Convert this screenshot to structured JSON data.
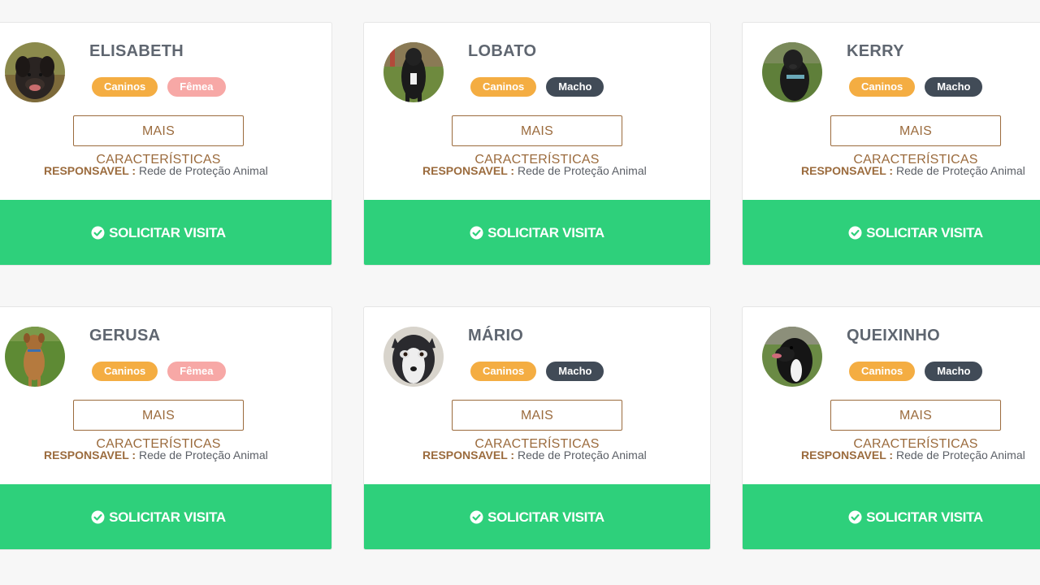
{
  "colors": {
    "species_tag": "#f4ad42",
    "female_tag": "#f7a8a6",
    "male_tag": "#414b57",
    "visit_button": "#2ed07b",
    "accent_brown": "#9b6b3d"
  },
  "cards": [
    {
      "name": "ELISABETH",
      "species": "Caninos",
      "sex": "Fêmea",
      "sex_kind": "female",
      "more_label": "MAIS CARACTERÍSTICAS",
      "owner_label": "RESPONSAVEL :",
      "owner_value": "Rede de Proteção Animal",
      "visit_label": "SOLICITAR VISITA"
    },
    {
      "name": "LOBATO",
      "species": "Caninos",
      "sex": "Macho",
      "sex_kind": "male",
      "more_label": "MAIS CARACTERÍSTICAS",
      "owner_label": "RESPONSAVEL :",
      "owner_value": "Rede de Proteção Animal",
      "visit_label": "SOLICITAR VISITA"
    },
    {
      "name": "KERRY",
      "species": "Caninos",
      "sex": "Macho",
      "sex_kind": "male",
      "more_label": "MAIS CARACTERÍSTICAS",
      "owner_label": "RESPONSAVEL :",
      "owner_value": "Rede de Proteção Animal",
      "visit_label": "SOLICITAR VISITA"
    },
    {
      "name": "GERUSA",
      "species": "Caninos",
      "sex": "Fêmea",
      "sex_kind": "female",
      "more_label": "MAIS CARACTERÍSTICAS",
      "owner_label": "RESPONSAVEL :",
      "owner_value": "Rede de Proteção Animal",
      "visit_label": "SOLICITAR VISITA"
    },
    {
      "name": "MÁRIO",
      "species": "Caninos",
      "sex": "Macho",
      "sex_kind": "male",
      "more_label": "MAIS CARACTERÍSTICAS",
      "owner_label": "RESPONSAVEL :",
      "owner_value": "Rede de Proteção Animal",
      "visit_label": "SOLICITAR VISITA"
    },
    {
      "name": "QUEIXINHO",
      "species": "Caninos",
      "sex": "Macho",
      "sex_kind": "male",
      "more_label": "MAIS CARACTERÍSTICAS",
      "owner_label": "RESPONSAVEL :",
      "owner_value": "Rede de Proteção Animal",
      "visit_label": "SOLICITAR VISITA"
    }
  ]
}
